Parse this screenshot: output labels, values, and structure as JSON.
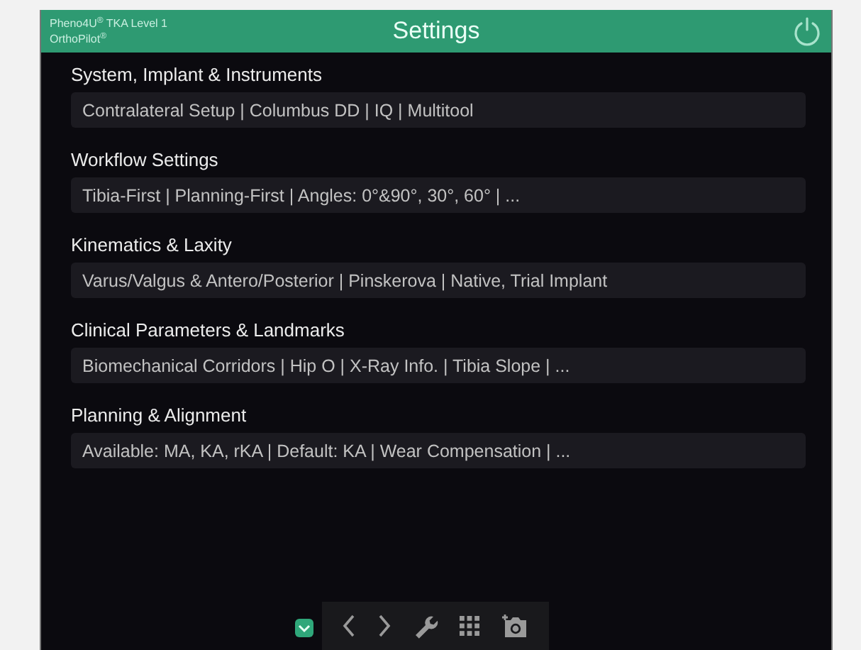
{
  "header": {
    "product": "Pheno4U$^{®}$ TKA Level 1",
    "system": "OrthoPilot$^{®}$",
    "title": "Settings"
  },
  "sections": [
    {
      "heading": "System, Implant & Instruments",
      "value": "Contralateral Setup | Columbus DD | IQ | Multitool"
    },
    {
      "heading": "Workflow Settings",
      "value": "Tibia-First | Planning-First | Angles: 0°&90°, 30°, 60° | ..."
    },
    {
      "heading": "Kinematics & Laxity",
      "value": "Varus/Valgus & Antero/Posterior | Pinskerova | Native, Trial Implant"
    },
    {
      "heading": "Clinical Parameters & Landmarks",
      "value": "Biomechanical Corridors | Hip O | X-Ray Info. | Tibia Slope | ..."
    },
    {
      "heading": "Planning & Alignment",
      "value": "Available: MA, KA, rKA | Default: KA | Wear Compensation | ..."
    }
  ],
  "toolbar": {
    "expander": {
      "expanded": true
    },
    "tools": [
      {
        "kind": "back"
      },
      {
        "kind": "forward"
      },
      {
        "kind": "wrench"
      },
      {
        "kind": "grid"
      },
      {
        "kind": "camera"
      }
    ]
  }
}
